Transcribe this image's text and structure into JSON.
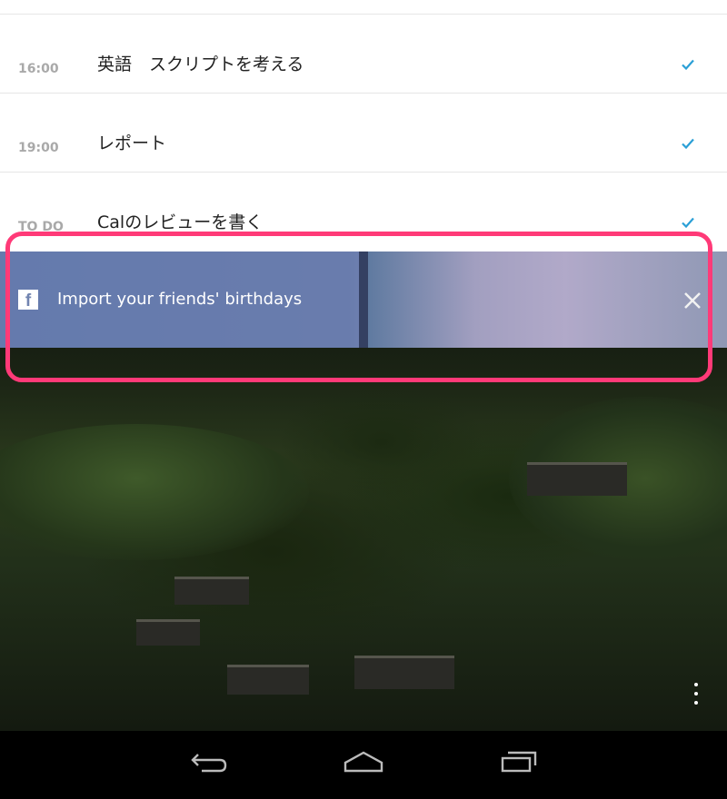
{
  "tasks": [
    {
      "time": "16:00",
      "title": "英語　スクリプトを考える"
    },
    {
      "time": "19:00",
      "title": "レポート"
    },
    {
      "time": "TO DO",
      "title": "Calのレビューを書く"
    }
  ],
  "banner": {
    "icon": "facebook-icon",
    "text": "Import your friends' birthdays"
  },
  "colors": {
    "check": "#2a9fd6",
    "highlight": "#ff3a78",
    "navbar": "#000000"
  },
  "navigation": {
    "back_icon": "back-icon",
    "home_icon": "home-icon",
    "recent_icon": "recent-apps-icon"
  }
}
